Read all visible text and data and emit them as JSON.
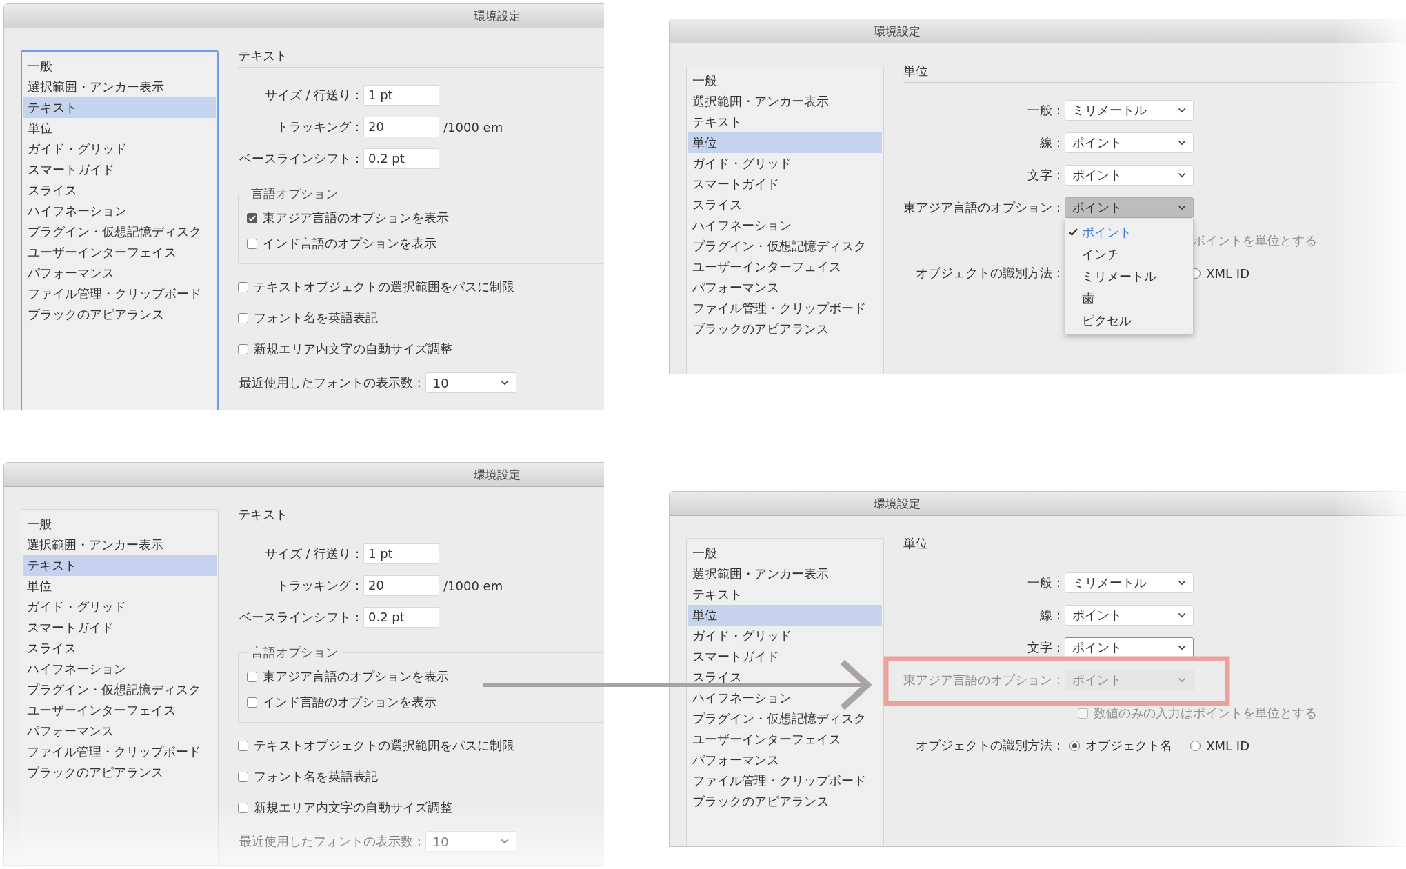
{
  "dialogs": [
    {
      "title": "環境設定",
      "kind": "text",
      "sidebar_focused": true,
      "sidebar": [
        {
          "label": "一般",
          "selected": false
        },
        {
          "label": "選択範囲・アンカー表示",
          "selected": false
        },
        {
          "label": "テキスト",
          "selected": true
        },
        {
          "label": "単位",
          "selected": false
        },
        {
          "label": "ガイド・グリッド",
          "selected": false
        },
        {
          "label": "スマートガイド",
          "selected": false
        },
        {
          "label": "スライス",
          "selected": false
        },
        {
          "label": "ハイフネーション",
          "selected": false
        },
        {
          "label": "プラグイン・仮想記憶ディスク",
          "selected": false
        },
        {
          "label": "ユーザーインターフェイス",
          "selected": false
        },
        {
          "label": "パフォーマンス",
          "selected": false
        },
        {
          "label": "ファイル管理・クリップボード",
          "selected": false
        },
        {
          "label": "ブラックのアピアランス",
          "selected": false
        }
      ],
      "section": "テキスト",
      "fields": [
        {
          "label": "サイズ / 行送り :",
          "value": "1 pt"
        },
        {
          "label": "トラッキング :",
          "value": "20",
          "unit": "/1000 em"
        },
        {
          "label": "ベースラインシフト :",
          "value": "0.2 pt"
        }
      ],
      "language_group": {
        "title": "言語オプション",
        "options": [
          {
            "label": "東アジア言語のオプションを表示",
            "checked": true
          },
          {
            "label": "インド言語のオプションを表示",
            "checked": false
          }
        ]
      },
      "checkboxes": [
        {
          "label": "テキストオブジェクトの選択範囲をパスに制限",
          "checked": false
        },
        {
          "label": "フォント名を英語表記",
          "checked": false
        },
        {
          "label": "新規エリア内文字の自動サイズ調整",
          "checked": false
        }
      ],
      "recent_fonts": {
        "label": "最近使用したフォントの表示数 :",
        "value": "10"
      }
    },
    {
      "title": "環境設定",
      "kind": "units",
      "sidebar_focused": false,
      "sidebar": [
        {
          "label": "一般",
          "selected": false
        },
        {
          "label": "選択範囲・アンカー表示",
          "selected": false
        },
        {
          "label": "テキスト",
          "selected": false
        },
        {
          "label": "単位",
          "selected": true
        },
        {
          "label": "ガイド・グリッド",
          "selected": false
        },
        {
          "label": "スマートガイド",
          "selected": false
        },
        {
          "label": "スライス",
          "selected": false
        },
        {
          "label": "ハイフネーション",
          "selected": false
        },
        {
          "label": "プラグイン・仮想記憶ディスク",
          "selected": false
        },
        {
          "label": "ユーザーインターフェイス",
          "selected": false
        },
        {
          "label": "パフォーマンス",
          "selected": false
        },
        {
          "label": "ファイル管理・クリップボード",
          "selected": false
        },
        {
          "label": "ブラックのアピアランス",
          "selected": false
        }
      ],
      "section": "単位",
      "selects": [
        {
          "label": "一般 :",
          "value": "ミリメートル",
          "open": false,
          "focused": false,
          "disabled": false
        },
        {
          "label": "線 :",
          "value": "ポイント",
          "open": false,
          "focused": false,
          "disabled": false
        },
        {
          "label": "文字 :",
          "value": "ポイント",
          "open": false,
          "focused": false,
          "disabled": false
        },
        {
          "label": "東アジア言語のオプション :",
          "value": "ポイント",
          "open": true,
          "focused": false,
          "disabled": false,
          "menu": [
            {
              "label": "ポイント",
              "selected": true
            },
            {
              "label": "インチ",
              "selected": false
            },
            {
              "label": "ミリメートル",
              "selected": false
            },
            {
              "label": "歯",
              "selected": false
            },
            {
              "label": "ピクセル",
              "selected": false
            }
          ]
        }
      ],
      "numeric_option": {
        "label": "ポイントを単位とする",
        "disabled": true
      },
      "object_id": {
        "label": "オブジェクトの識別方法 :",
        "options": [
          {
            "label": "XML ID",
            "selected": false
          }
        ]
      }
    },
    {
      "title": "環境設定",
      "kind": "text",
      "sidebar_focused": false,
      "sidebar": [
        {
          "label": "一般",
          "selected": false
        },
        {
          "label": "選択範囲・アンカー表示",
          "selected": false
        },
        {
          "label": "テキスト",
          "selected": true
        },
        {
          "label": "単位",
          "selected": false
        },
        {
          "label": "ガイド・グリッド",
          "selected": false
        },
        {
          "label": "スマートガイド",
          "selected": false
        },
        {
          "label": "スライス",
          "selected": false
        },
        {
          "label": "ハイフネーション",
          "selected": false
        },
        {
          "label": "プラグイン・仮想記憶ディスク",
          "selected": false
        },
        {
          "label": "ユーザーインターフェイス",
          "selected": false
        },
        {
          "label": "パフォーマンス",
          "selected": false
        },
        {
          "label": "ファイル管理・クリップボード",
          "selected": false
        },
        {
          "label": "ブラックのアピアランス",
          "selected": false
        }
      ],
      "section": "テキスト",
      "fields": [
        {
          "label": "サイズ / 行送り :",
          "value": "1 pt"
        },
        {
          "label": "トラッキング :",
          "value": "20",
          "unit": "/1000 em"
        },
        {
          "label": "ベースラインシフト :",
          "value": "0.2 pt"
        }
      ],
      "language_group": {
        "title": "言語オプション",
        "options": [
          {
            "label": "東アジア言語のオプションを表示",
            "checked": false
          },
          {
            "label": "インド言語のオプションを表示",
            "checked": false
          }
        ]
      },
      "checkboxes": [
        {
          "label": "テキストオブジェクトの選択範囲をパスに制限",
          "checked": false
        },
        {
          "label": "フォント名を英語表記",
          "checked": false
        },
        {
          "label": "新規エリア内文字の自動サイズ調整",
          "checked": false
        }
      ],
      "recent_fonts": {
        "label": "最近使用したフォントの表示数 :",
        "value": "10"
      }
    },
    {
      "title": "環境設定",
      "kind": "units",
      "sidebar_focused": false,
      "sidebar": [
        {
          "label": "一般",
          "selected": false
        },
        {
          "label": "選択範囲・アンカー表示",
          "selected": false
        },
        {
          "label": "テキスト",
          "selected": false
        },
        {
          "label": "単位",
          "selected": true
        },
        {
          "label": "ガイド・グリッド",
          "selected": false
        },
        {
          "label": "スマートガイド",
          "selected": false
        },
        {
          "label": "スライス",
          "selected": false
        },
        {
          "label": "ハイフネーション",
          "selected": false
        },
        {
          "label": "プラグイン・仮想記憶ディスク",
          "selected": false
        },
        {
          "label": "ユーザーインターフェイス",
          "selected": false
        },
        {
          "label": "パフォーマンス",
          "selected": false
        },
        {
          "label": "ファイル管理・クリップボード",
          "selected": false
        },
        {
          "label": "ブラックのアピアランス",
          "selected": false
        }
      ],
      "section": "単位",
      "selects": [
        {
          "label": "一般 :",
          "value": "ミリメートル",
          "open": false,
          "focused": false,
          "disabled": false
        },
        {
          "label": "線 :",
          "value": "ポイント",
          "open": false,
          "focused": false,
          "disabled": false
        },
        {
          "label": "文字 :",
          "value": "ポイント",
          "open": false,
          "focused": true,
          "disabled": false
        },
        {
          "label": "東アジア言語のオプション :",
          "value": "ポイント",
          "open": false,
          "focused": false,
          "disabled": true
        }
      ],
      "numeric_option": {
        "label": "数値のみの入力はポイントを単位とする",
        "disabled": true,
        "checked": false
      },
      "object_id": {
        "label": "オブジェクトの識別方法 :",
        "options": [
          {
            "label": "オブジェクト名",
            "selected": true
          },
          {
            "label": "XML ID",
            "selected": false
          }
        ]
      }
    }
  ]
}
